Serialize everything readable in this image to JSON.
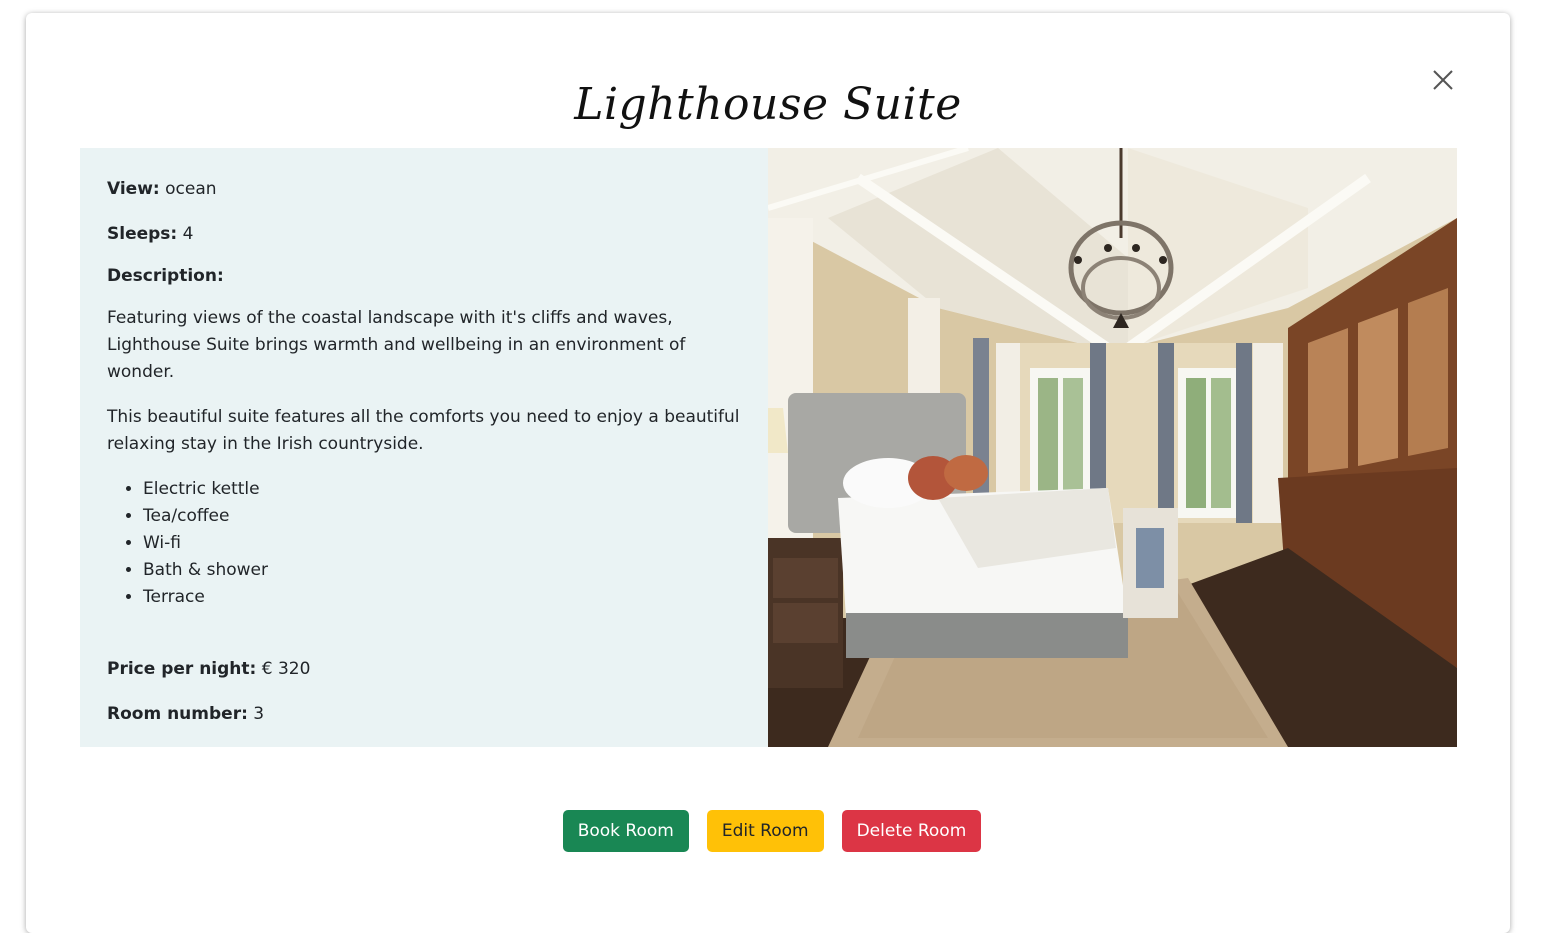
{
  "modal": {
    "title": "Lighthouse Suite",
    "close_icon": "close-icon"
  },
  "room": {
    "view_label": "View:",
    "view_value": "ocean",
    "sleeps_label": "Sleeps:",
    "sleeps_value": "4",
    "description_label": "Description:",
    "description_paragraphs": [
      "Featuring views of the coastal landscape with it's cliffs and waves, Lighthouse Suite brings warmth and wellbeing in an environment of wonder.",
      "This beautiful suite features all the comforts you need to enjoy a beautiful relaxing stay in the Irish countryside."
    ],
    "amenities": [
      "Electric kettle",
      "Tea/coffee",
      "Wi-fi",
      "Bath & shower",
      "Terrace"
    ],
    "price_label": "Price per night:",
    "price_value": "€ 320",
    "room_number_label": "Room number:",
    "room_number_value": "3"
  },
  "actions": {
    "book_label": "Book Room",
    "edit_label": "Edit Room",
    "delete_label": "Delete Room"
  },
  "colors": {
    "panel_bg": "#eaf3f4",
    "book": "#198754",
    "edit": "#ffc107",
    "delete": "#dc3545"
  }
}
